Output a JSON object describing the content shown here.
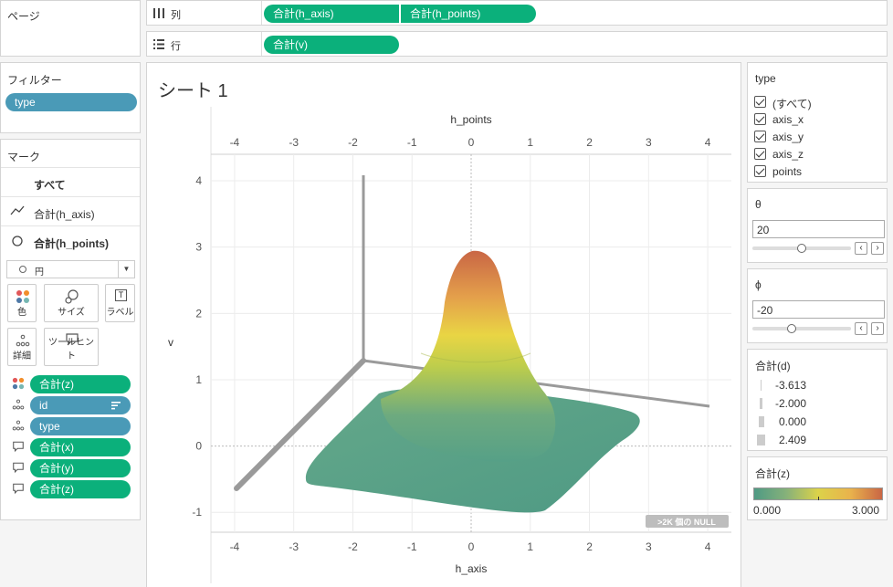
{
  "pages": {
    "title": "ページ"
  },
  "shelves": {
    "columns_label": "列",
    "rows_label": "行",
    "columns": [
      "合計(h_axis)",
      "合計(h_points)"
    ],
    "rows": [
      "合計(v)"
    ]
  },
  "filters": {
    "title": "フィルター",
    "items": [
      "type"
    ]
  },
  "marks": {
    "title": "マーク",
    "all": "すべて",
    "layers": [
      "合計(h_axis)",
      "合計(h_points)"
    ],
    "mark_type": "円",
    "buttons": {
      "color": "色",
      "size": "サイズ",
      "label": "ラベル",
      "detail": "詳細",
      "tooltip": "ツールヒント"
    },
    "fields": [
      "合計(z)",
      "id",
      "type",
      "合計(x)",
      "合計(y)",
      "合計(z)"
    ]
  },
  "sheet": {
    "title": "シート 1",
    "top_axis_title": "h_points",
    "bottom_axis_title": "h_axis",
    "y_axis_title": "v",
    "null_badge": ">2K 個の NULL"
  },
  "chart_data": {
    "type": "scatter",
    "x_ticks": [
      -4,
      -3,
      -2,
      -1,
      0,
      1,
      2,
      3,
      4
    ],
    "y_ticks": [
      -1,
      0,
      1,
      2,
      3,
      4
    ],
    "xlim": [
      -4.4,
      4.4
    ],
    "ylim": [
      -1.3,
      4.4
    ],
    "surface": {
      "peak": 3.0,
      "baseline": 0.0
    }
  },
  "type_filter": {
    "title": "type",
    "options": [
      "(すべて)",
      "axis_x",
      "axis_y",
      "axis_z",
      "points"
    ]
  },
  "theta": {
    "title": "θ",
    "value": "20",
    "fraction": 0.5
  },
  "phi": {
    "title": "ϕ",
    "value": "-20",
    "fraction": 0.4
  },
  "size_legend": {
    "title": "合計(d)",
    "values": [
      "-3.613",
      "-2.000",
      "0.000",
      "2.409"
    ]
  },
  "color_legend": {
    "title": "合計(z)",
    "min": "0.000",
    "max": "3.000"
  },
  "colors": {
    "green": "#0bb07b",
    "blue": "#4a9ab7"
  }
}
